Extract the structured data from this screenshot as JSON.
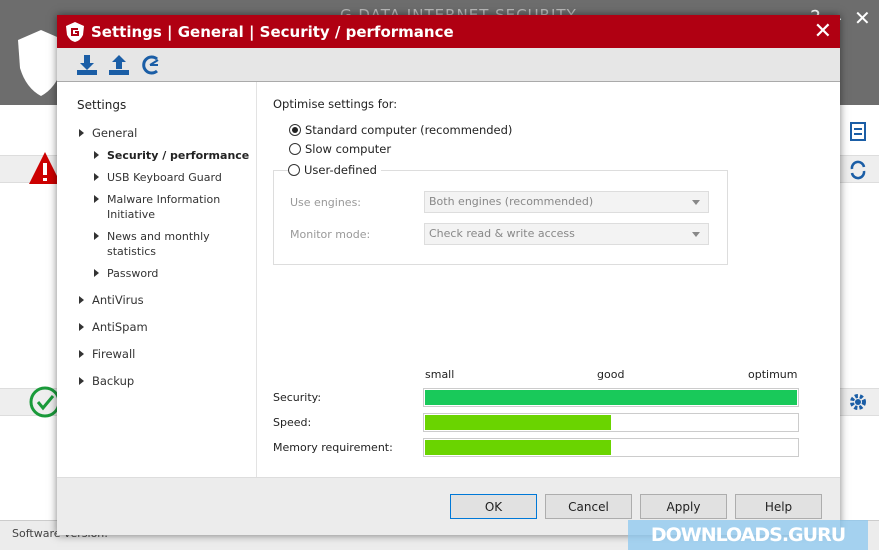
{
  "background": {
    "app_title": "G DATA INTERNET SECURITY",
    "help": "?",
    "minimize": "–",
    "close": "✕",
    "status": "Software version:"
  },
  "dialog": {
    "title": "Settings | General | Security / performance",
    "close": "✕"
  },
  "toolbar": {
    "icons": [
      "import-icon",
      "export-icon",
      "reset-icon"
    ]
  },
  "sidebar": {
    "heading": "Settings",
    "items": [
      {
        "label": "General",
        "level": 1
      },
      {
        "label": "Security / performance",
        "level": 2
      },
      {
        "label": "USB Keyboard Guard",
        "level": 2
      },
      {
        "label": "Malware Information Initiative",
        "level": 2
      },
      {
        "label": "News and monthly statistics",
        "level": 2
      },
      {
        "label": "Password",
        "level": 2
      },
      {
        "label": "AntiVirus",
        "level": 1
      },
      {
        "label": "AntiSpam",
        "level": 1
      },
      {
        "label": "Firewall",
        "level": 1
      },
      {
        "label": "Backup",
        "level": 1
      }
    ]
  },
  "main": {
    "optimise_label": "Optimise settings for:",
    "options": [
      {
        "label": "Standard computer (recommended)",
        "checked": true
      },
      {
        "label": "Slow computer",
        "checked": false
      },
      {
        "label": "User-defined",
        "checked": false
      }
    ],
    "engines_label": "Use engines:",
    "engines_value": "Both engines (recommended)",
    "monitor_label": "Monitor mode:",
    "monitor_value": "Check read & write access",
    "scale": [
      "small",
      "good",
      "optimum"
    ],
    "ratings": [
      {
        "label": "Security:",
        "percent": 100,
        "color": "#19c95a"
      },
      {
        "label": "Speed:",
        "percent": 50,
        "color": "#6ad400"
      },
      {
        "label": "Memory requirement:",
        "percent": 50,
        "color": "#6ad400"
      }
    ]
  },
  "footer": {
    "ok": "OK",
    "cancel": "Cancel",
    "apply": "Apply",
    "help": "Help"
  },
  "watermark": "DOWNLOADS.GURU"
}
